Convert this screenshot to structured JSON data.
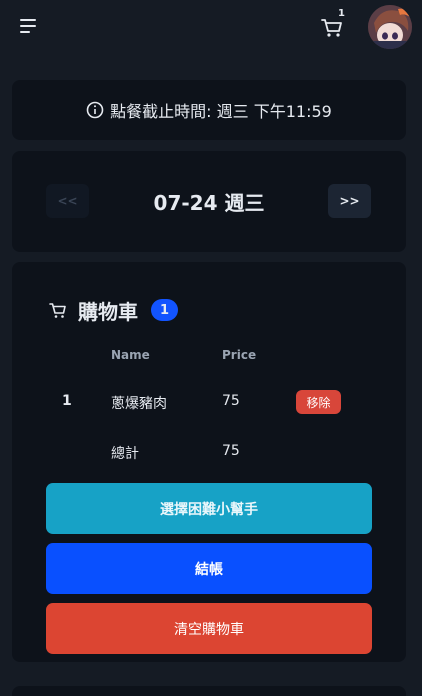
{
  "topbar": {
    "menu_icon": "hamburger-menu-icon",
    "cart_icon": "shopping-cart-icon",
    "cart_count": "1",
    "avatar_icon": "user-avatar"
  },
  "deadline": {
    "icon": "info-circle-icon",
    "text": "點餐截止時間: 週三 下午11:59"
  },
  "date_nav": {
    "prev_label": "<<",
    "date": "07-24 週三",
    "next_label": ">>"
  },
  "cart": {
    "icon": "shopping-cart-icon",
    "title": "購物車",
    "badge": "1",
    "columns": [
      "Name",
      "Price"
    ],
    "items": [
      {
        "index": "1",
        "name": "蔥爆豬肉",
        "price": "75",
        "remove_label": "移除"
      }
    ],
    "total_label": "總計",
    "total_value": "75",
    "helper_button": "選擇困難小幫手",
    "checkout_button": "結帳",
    "clear_button": "清空購物車"
  },
  "colors": {
    "background": "#151b24",
    "card": "#0d121a",
    "badge_blue": "#1254ff",
    "helper_cyan": "#17a2c6",
    "checkout_blue": "#0950ff",
    "danger_red": "#dc4532"
  }
}
